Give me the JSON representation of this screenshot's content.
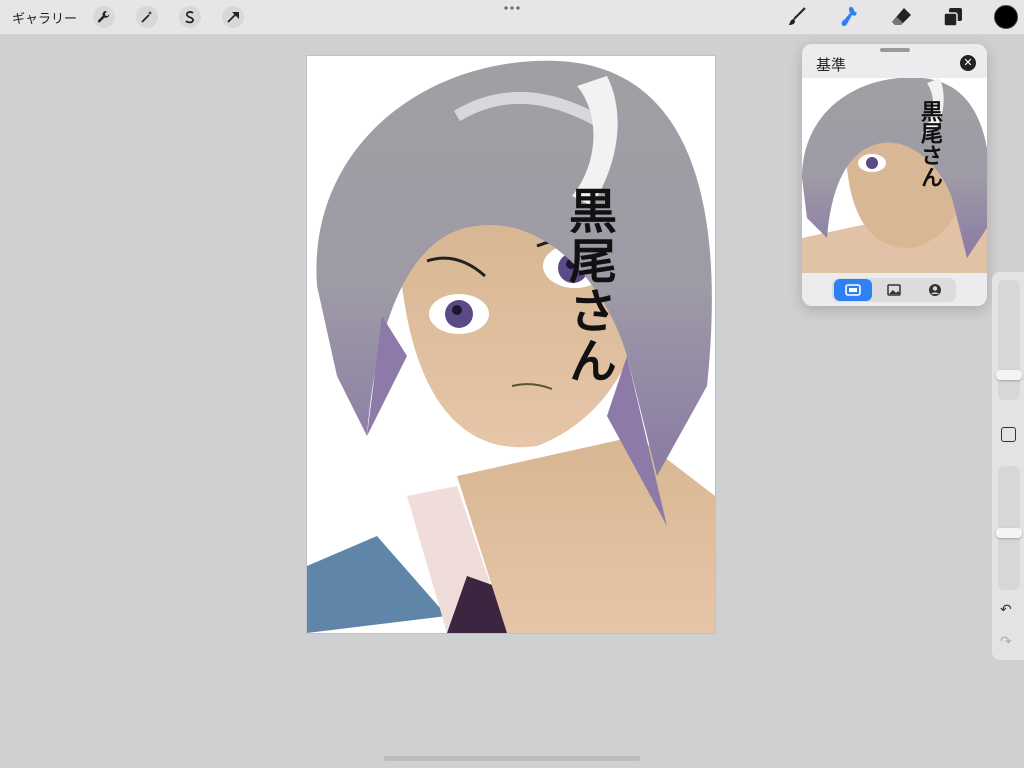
{
  "topbar": {
    "gallery_label": "ギャラリー",
    "left_tools": [
      "wrench-icon",
      "magic-wand-icon",
      "selection-icon",
      "transform-icon"
    ],
    "right_tools": [
      "brush-icon",
      "smudge-icon",
      "eraser-icon",
      "layers-icon"
    ],
    "active_tool": "smudge-icon",
    "active_color": "#000000",
    "accent": "#2f7ff5"
  },
  "canvas": {
    "text": "黒尾さん"
  },
  "reference": {
    "title": "基準",
    "image_text": "黒尾さん",
    "modes": [
      "canvas-mode-icon",
      "image-mode-icon",
      "face-mode-icon"
    ],
    "active_mode": "canvas-mode-icon"
  },
  "sidebar": {
    "undo_label": "↶",
    "redo_label": "↷"
  }
}
